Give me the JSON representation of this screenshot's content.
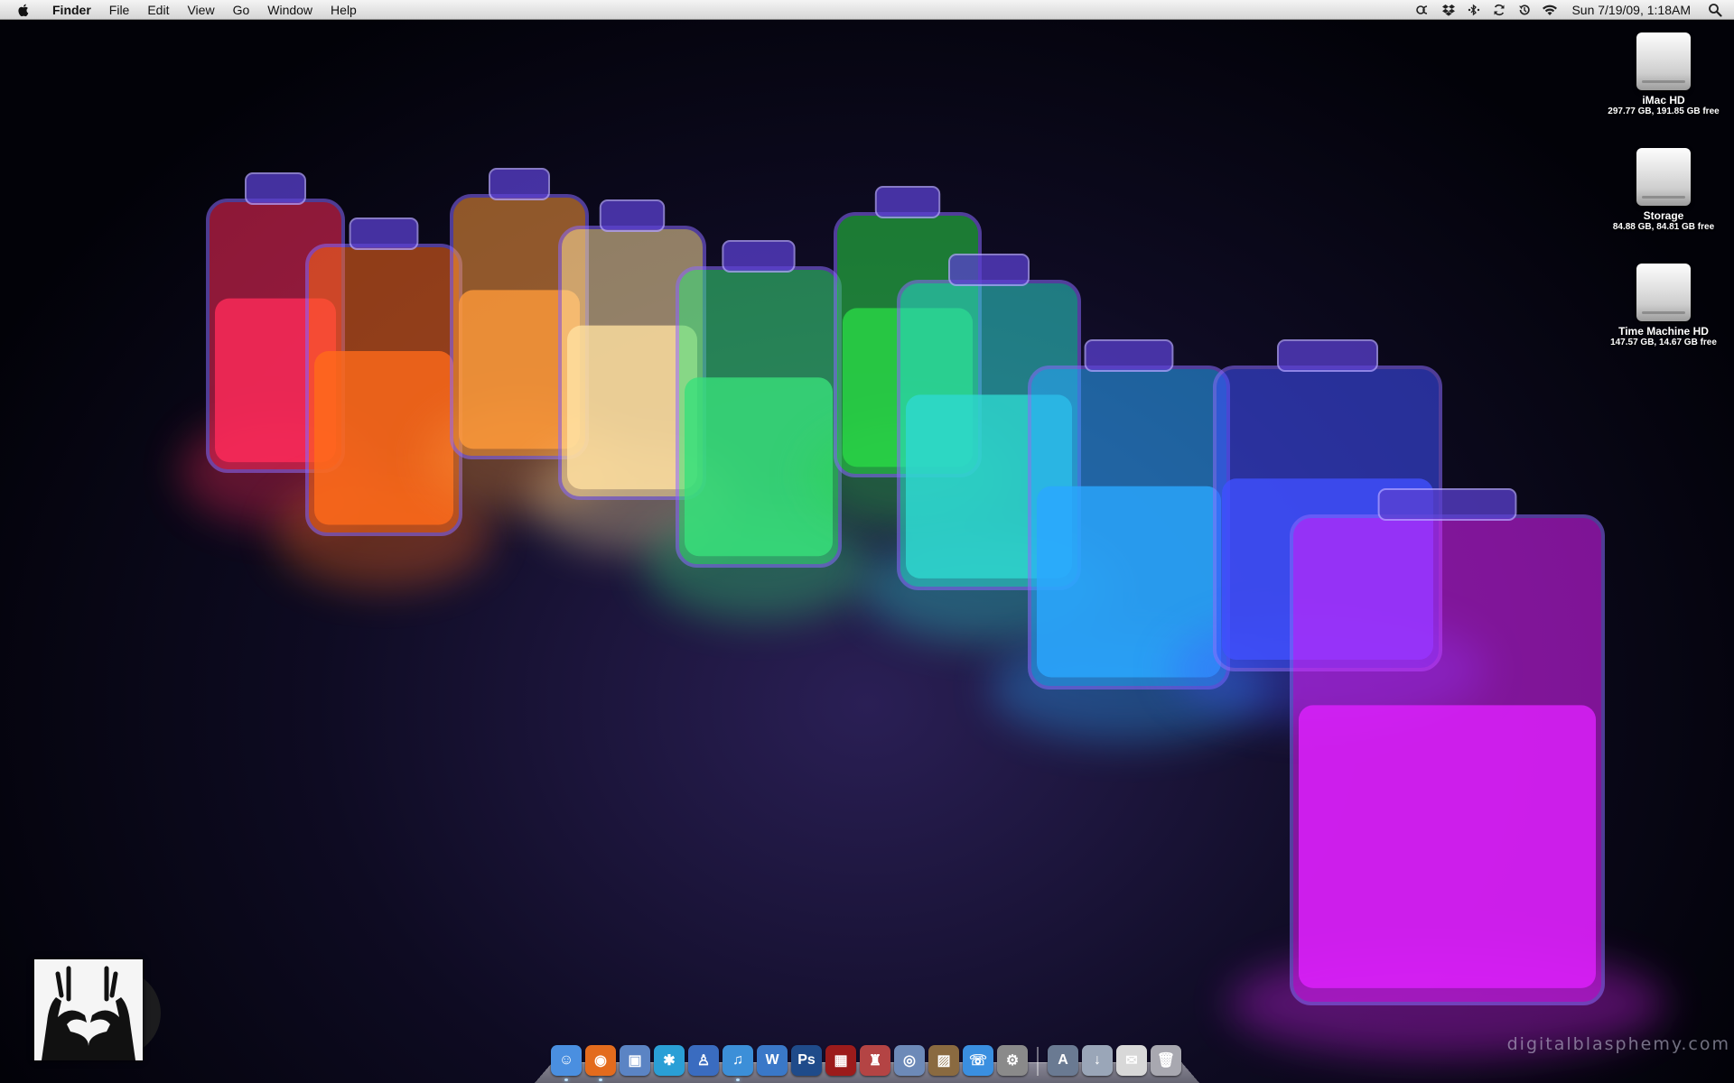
{
  "menubar": {
    "apple_icon": "apple-icon",
    "app_name": "Finder",
    "menus": [
      "File",
      "Edit",
      "View",
      "Go",
      "Window",
      "Help"
    ],
    "status_icons": [
      "creative-suite-icon",
      "dropbox-icon",
      "bluetooth-icon",
      "sync-icon",
      "time-machine-icon",
      "wifi-icon"
    ],
    "clock": "Sun 7/19/09, 1:18AM",
    "spotlight_icon": "spotlight-icon"
  },
  "desktop": {
    "drives": [
      {
        "name": "iMac HD",
        "info": "297.77 GB, 191.85 GB free"
      },
      {
        "name": "Storage",
        "info": "84.88 GB, 84.81 GB free"
      },
      {
        "name": "Time Machine HD",
        "info": "147.57 GB, 14.67 GB free"
      }
    ],
    "watermark": "digitalblasphemy.com"
  },
  "wallpaper": {
    "jar_colors": [
      "#ff2a5a",
      "#ff6a1a",
      "#ff9a3a",
      "#ffe0a0",
      "#38e07a",
      "#29d846",
      "#2ed8d0",
      "#2aa8ff",
      "#4050ff",
      "#e020ff"
    ]
  },
  "dock": {
    "apps": [
      {
        "name": "finder-icon",
        "color": "#4a8fe0",
        "glyph": "☺",
        "running": true
      },
      {
        "name": "firefox-icon",
        "color": "#e36b1d",
        "glyph": "◉",
        "running": true
      },
      {
        "name": "preview-icon",
        "color": "#5b84c4",
        "glyph": "▣",
        "running": false
      },
      {
        "name": "network-utility-icon",
        "color": "#2a9fd6",
        "glyph": "✱",
        "running": false
      },
      {
        "name": "automator-icon",
        "color": "#3a6cc0",
        "glyph": "♙",
        "running": false
      },
      {
        "name": "itunes-icon",
        "color": "#3c8fd8",
        "glyph": "♫",
        "running": true
      },
      {
        "name": "word-icon",
        "color": "#3a78c8",
        "glyph": "W",
        "running": false
      },
      {
        "name": "photoshop-icon",
        "color": "#1f4b8a",
        "glyph": "Ps",
        "running": false
      },
      {
        "name": "dvd-player-icon",
        "color": "#9c1b1b",
        "glyph": "▦",
        "running": false
      },
      {
        "name": "delicious-library-icon",
        "color": "#b44444",
        "glyph": "♜",
        "running": false
      },
      {
        "name": "quicktime-icon",
        "color": "#6d8ab8",
        "glyph": "◎",
        "running": false
      },
      {
        "name": "iphoto-icon",
        "color": "#8a6a40",
        "glyph": "▨",
        "running": false
      },
      {
        "name": "ichat-icon",
        "color": "#3a8fe0",
        "glyph": "☏",
        "running": false
      },
      {
        "name": "system-preferences-icon",
        "color": "#8a8a8a",
        "glyph": "⚙",
        "running": false
      }
    ],
    "stacks": [
      {
        "name": "applications-stack-icon",
        "color": "#6a7a92",
        "glyph": "A"
      },
      {
        "name": "downloads-stack-icon",
        "color": "#9aa6b8",
        "glyph": "↓"
      },
      {
        "name": "documents-stack-icon",
        "color": "#d8d8d8",
        "glyph": "✉"
      },
      {
        "name": "trash-icon",
        "color": "#a8a8b0",
        "glyph": "🗑"
      }
    ]
  }
}
